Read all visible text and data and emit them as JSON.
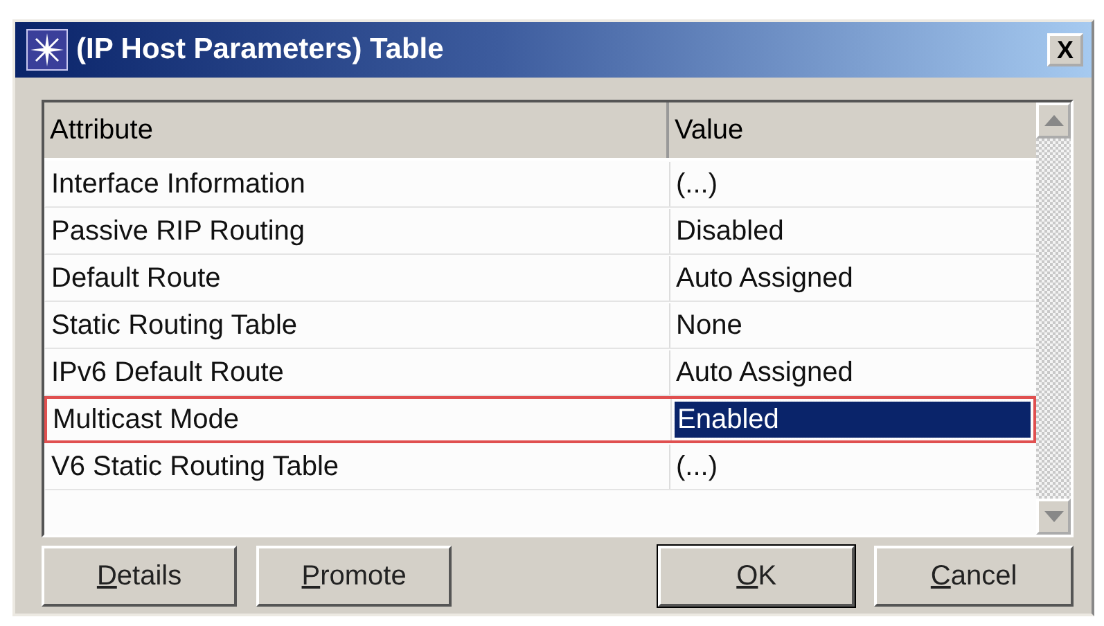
{
  "window": {
    "title": "(IP Host Parameters) Table",
    "close": "X"
  },
  "table": {
    "columns": [
      "Attribute",
      "Value"
    ],
    "rows": [
      {
        "attribute": "Interface Information",
        "value": "(...)",
        "selected": false
      },
      {
        "attribute": "Passive RIP Routing",
        "value": "Disabled",
        "selected": false
      },
      {
        "attribute": "Default Route",
        "value": "Auto Assigned",
        "selected": false
      },
      {
        "attribute": "Static Routing Table",
        "value": "None",
        "selected": false
      },
      {
        "attribute": "IPv6 Default Route",
        "value": "Auto Assigned",
        "selected": false
      },
      {
        "attribute": "Multicast Mode",
        "value": "Enabled",
        "selected": true
      },
      {
        "attribute": "V6 Static Routing Table",
        "value": "(...)",
        "selected": false
      }
    ]
  },
  "buttons": [
    {
      "mnemonic": "D",
      "rest": "etails",
      "default": false
    },
    {
      "mnemonic": "P",
      "rest": "romote",
      "default": false
    },
    {
      "mnemonic": "O",
      "rest": "K",
      "default": true
    },
    {
      "mnemonic": "C",
      "rest": "ancel",
      "default": false
    }
  ]
}
